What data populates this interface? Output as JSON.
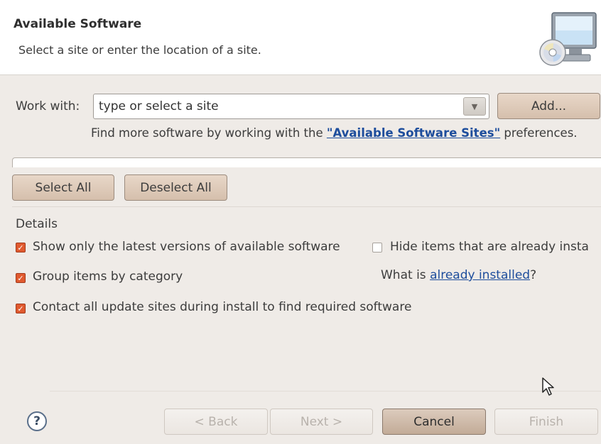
{
  "header": {
    "title": "Available Software",
    "subtitle": "Select a site or enter the location of a site."
  },
  "work_with": {
    "label": "Work with:",
    "value": "type or select a site",
    "add_button": "Add...",
    "find_more_prefix": "Find more software by working with the ",
    "find_more_link": "\"Available Software Sites\"",
    "find_more_suffix": " preferences."
  },
  "selection": {
    "select_all": "Select All",
    "deselect_all": "Deselect All"
  },
  "details": {
    "label": "Details",
    "show_latest": {
      "label": "Show only the latest versions of available software",
      "checked": true
    },
    "hide_installed": {
      "label": "Hide items that are already insta",
      "checked": false
    },
    "group_by_category": {
      "label": "Group items by category",
      "checked": true
    },
    "what_is_prefix": "What is ",
    "what_is_link": "already installed",
    "what_is_suffix": "?",
    "contact_sites": {
      "label": "Contact all update sites during install to find required software",
      "checked": true
    }
  },
  "footer": {
    "help": "?",
    "back": "< Back",
    "next": "Next >",
    "cancel": "Cancel",
    "finish": "Finish"
  },
  "colors": {
    "background": "#efebe7",
    "button": "#d5bfac",
    "checkbox_checked": "#e05a2f",
    "link": "#1d4d9c"
  }
}
